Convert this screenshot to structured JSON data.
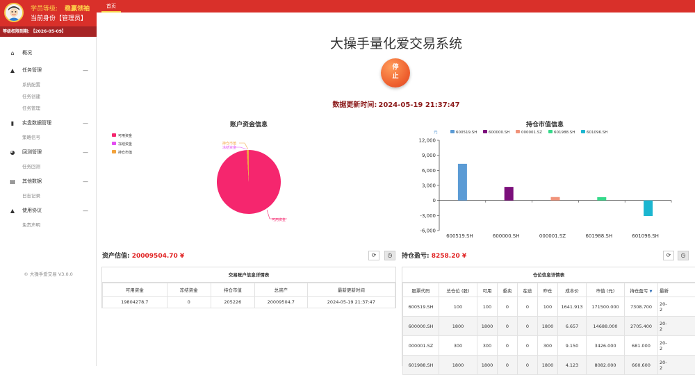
{
  "header": {
    "tab_home": "首页",
    "title": "大操手量化爱交易系统",
    "stop_button": "停止",
    "update_label": "数据更新时间:",
    "update_time": "2024-05-19 21:37:47"
  },
  "sidebar": {
    "level_label": "学员等级:",
    "level_value": "稳赢领袖",
    "identity": "当前身份【管理员】",
    "expire": "等级权限到期:  【2026-05-09】",
    "version": "© 大操手爱交易 V3.0.0",
    "items": [
      {
        "label": "概况",
        "icon": "home-icon",
        "glyph": "⌂"
      },
      {
        "label": "任务管理",
        "icon": "area-chart-icon",
        "glyph": "▲",
        "toggle": "—"
      },
      {
        "label": "系统配置"
      },
      {
        "label": "任务创建"
      },
      {
        "label": "任务管理"
      },
      {
        "label": "实盘数据管理",
        "icon": "bar-chart-icon",
        "glyph": "▮",
        "toggle": "—"
      },
      {
        "label": "策略信号"
      },
      {
        "label": "回测管理",
        "icon": "pie-chart-icon",
        "glyph": "◕",
        "toggle": "—"
      },
      {
        "label": "任务回测"
      },
      {
        "label": "其他数据",
        "icon": "file-icon",
        "glyph": "▤",
        "toggle": "—"
      },
      {
        "label": "日志记录"
      },
      {
        "label": "使用协议",
        "icon": "warning-icon",
        "glyph": "▲",
        "toggle": "—"
      },
      {
        "label": "免责声明"
      }
    ]
  },
  "charts": {
    "account_title": "账户资金信息",
    "position_title": "持仓市值信息",
    "y_unit": "元"
  },
  "chart_data": [
    {
      "type": "pie",
      "title": "账户资金信息",
      "labels": [
        "可用资金",
        "冻结资金",
        "持仓市值"
      ],
      "values": [
        19804278.7,
        0,
        205226
      ],
      "colors": [
        "#f5266e",
        "#e34df2",
        "#f2a23c"
      ]
    },
    {
      "type": "bar",
      "title": "持仓市值信息",
      "ylabel": "元",
      "categories": [
        "600519.SH",
        "600000.SH",
        "000001.SZ",
        "601988.SH",
        "601096.SH"
      ],
      "values": [
        7308.7,
        2705.4,
        681.0,
        660.6,
        -3097.5
      ],
      "colors": [
        "#5b9bd5",
        "#7b0f7b",
        "#f0937a",
        "#35d98a",
        "#1cb6d0"
      ],
      "ylim": [
        -6000,
        12000
      ],
      "yticks": [
        "12,000",
        "9,000",
        "6,000",
        "3,000",
        "0",
        "-3,000",
        "-6,000"
      ],
      "legend_position": "top"
    }
  ],
  "assets": {
    "label": "资产估值:",
    "value": "20009504.70 ¥",
    "table_title": "交易账户信息详情表",
    "columns": [
      "可用资金",
      "冻结资金",
      "持仓市值",
      "总资产",
      "最新更新时间"
    ],
    "rows": [
      [
        "19804278.7",
        "0",
        "205226",
        "20009504.7",
        "2024-05-19 21:37:47"
      ]
    ]
  },
  "positions": {
    "label": "持仓盈亏:",
    "value": "8258.20 ¥",
    "table_title": "仓位信息详情表",
    "columns": [
      "股票代码",
      "总仓位 (股)",
      "可用",
      "委卖",
      "在途",
      "昨仓",
      "成本价",
      "市值 (元)",
      "持仓盈亏",
      "最新"
    ],
    "sort_glyph": "▼",
    "rows": [
      [
        "600519.SH",
        "100",
        "100",
        "0",
        "0",
        "100",
        "1641.913",
        "171500.000",
        "7308.700",
        "20-\n2"
      ],
      [
        "600000.SH",
        "1800",
        "1800",
        "0",
        "0",
        "1800",
        "6.657",
        "14688.000",
        "2705.400",
        "20-\n2"
      ],
      [
        "000001.SZ",
        "300",
        "300",
        "0",
        "0",
        "300",
        "9.150",
        "3426.000",
        "681.000",
        "20-\n2"
      ],
      [
        "601988.SH",
        "1800",
        "1800",
        "0",
        "0",
        "1800",
        "4.123",
        "8082.000",
        "660.600",
        "20-\n2"
      ]
    ]
  },
  "controls": {
    "refresh_glyph": "⟳",
    "clock_glyph": "◷"
  }
}
